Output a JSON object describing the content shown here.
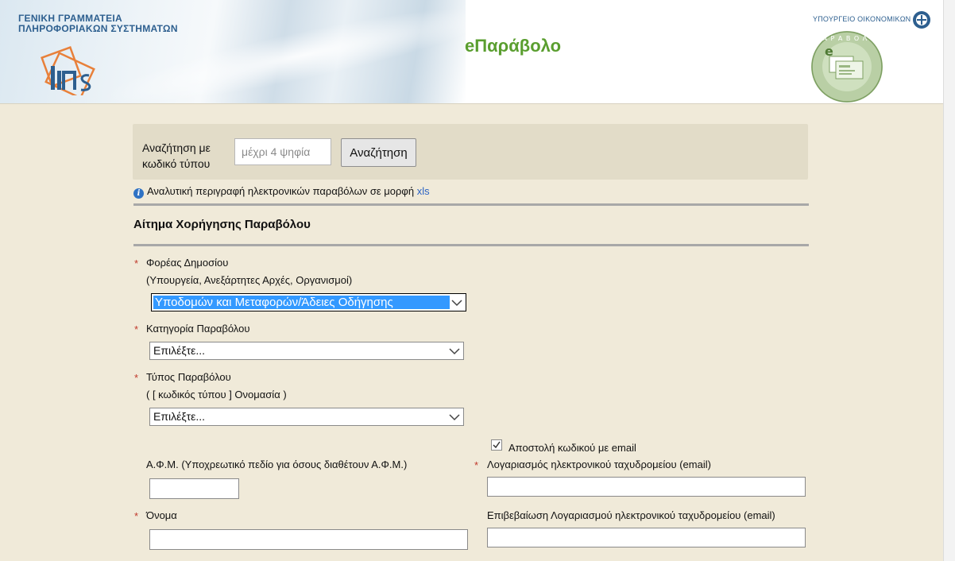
{
  "header": {
    "org_line1": "ΓΕΝΙΚΗ ΓΡΑΜΜΑΤΕΙΑ",
    "org_line2": "ΠΛΗΡΟΦΟΡΙΑΚΩΝ ΣΥΣΤΗΜΑΤΩΝ",
    "app_title": "eΠαράβολο",
    "ministry": "ΥΠΟΥΡΓΕΙΟ ΟΙΚΟΝΟΜΙΚΩΝ",
    "seal_text": "e - Π Α Ρ Α Β Ο Λ Ο"
  },
  "search": {
    "label": "Αναζήτηση με κωδικό τύπου",
    "placeholder": "μέχρι 4 ψηφία",
    "button": "Αναζήτηση"
  },
  "info": {
    "text": "Αναλυτική περιγραφή ηλεκτρονικών παραβόλων σε μορφή ",
    "link": "xls"
  },
  "form": {
    "title": "Αίτημα Χορήγησης Παραβόλου",
    "required_mark": "*",
    "agency_label": "Φορέας Δημοσίου",
    "agency_hint": "(Υπουργεία, Ανεξάρτητες Αρχές, Οργανισμοί)",
    "agency_value": "Υποδομών και Μεταφορών/Άδειες Οδήγησης",
    "category_label": "Κατηγορία Παραβόλου",
    "category_value": "Επιλέξτε...",
    "type_label": "Τύπος Παραβόλου",
    "type_hint": "( [ κωδικός τύπου ] Ονομασία )",
    "type_value": "Επιλέξτε...",
    "send_email_label": "Αποστολή κωδικού με email",
    "send_email_checked": true,
    "afm_label": "Α.Φ.Μ. (Υποχρεωτικό πεδίο για όσους διαθέτουν Α.Φ.Μ.)",
    "email_label": "Λογαριασμός ηλεκτρονικού ταχυδρομείου (email)",
    "name_label": "Όνομα",
    "email_confirm_label": "Επιβεβαίωση Λογαριασμού ηλεκτρονικού ταχυδρομείου (email)"
  },
  "colors": {
    "background": "#f0ead9",
    "search_box": "#e2dcc8",
    "app_title": "#5a9e2f",
    "required": "#c0392b",
    "link": "#2b63c4",
    "selection": "#3399ff"
  }
}
